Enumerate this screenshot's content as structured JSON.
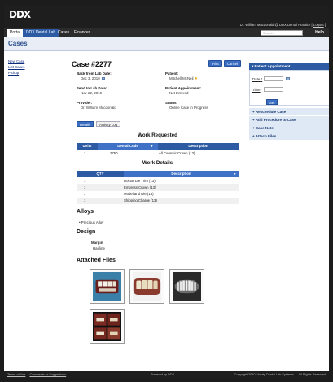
{
  "header": {
    "logo": "DDX",
    "user_prefix": "Dr. William Macdonald @ DDX Dental Practice",
    "logout": "Logout"
  },
  "nav": {
    "tabs": [
      "Portal",
      "DDX Dental Lab",
      "Cases",
      "Finances"
    ],
    "search_placeholder": "Search",
    "help": "Help"
  },
  "page": {
    "title": "Cases"
  },
  "sidebar": {
    "items": [
      "New Case",
      "List Cases",
      "Pickup"
    ]
  },
  "case": {
    "title": "Case #2277",
    "print_label": "Print",
    "cancel_label": "Cancel",
    "back_label": "Back from Lab Date:",
    "back_value": "Dec 3, 2010",
    "patient_label": "Patient:",
    "patient_value": "Mitchell McNeil",
    "send_label": "Send to Lab Date:",
    "send_value": "Nov 22, 2010",
    "appt_label": "Patient Appointment:",
    "appt_value": "Not Entered",
    "provider_label": "Provider:",
    "provider_value": "Dr. William Macdonald",
    "status_label": "Status:",
    "status_value": "Online Case in Progress"
  },
  "detail_tabs": [
    "Details",
    "Activity Log"
  ],
  "work_requested": {
    "title": "Work Requested",
    "columns": [
      "Units",
      "Dental Code",
      "Description"
    ],
    "rows": [
      [
        "1",
        "2750",
        "All Ceramic Crown (13)"
      ]
    ]
  },
  "work_details": {
    "title": "Work Details",
    "columns": [
      "QTY",
      "Description"
    ],
    "rows": [
      [
        "1",
        "Doctor Die Trim (13)"
      ],
      [
        "1",
        "Empress Crown (13)"
      ],
      [
        "1",
        "Model and Die (13)"
      ],
      [
        "1",
        "Shipping Charge (13)"
      ]
    ]
  },
  "alloys": {
    "title": "Alloys",
    "items": [
      "Precious Alloy"
    ]
  },
  "design": {
    "title": "Design",
    "margin_label": "Margin",
    "margin_value": "Hairline"
  },
  "attached": {
    "title": "Attached Files"
  },
  "right_panel": {
    "appointment_title": "Patient Appointment",
    "date_label": "Date",
    "time_label": "Time",
    "set_label": "Set",
    "items": [
      "Reschedule Case",
      "Add Procedure to Case",
      "Case Note",
      "Attach Files"
    ]
  },
  "footer": {
    "links": [
      "Terms of Use",
      "Comments or Suggestions"
    ],
    "center": "Powered by DDX",
    "copyright": "Copyright 2010 Liberty Dental Lab Systems — All Rights Reserved"
  }
}
